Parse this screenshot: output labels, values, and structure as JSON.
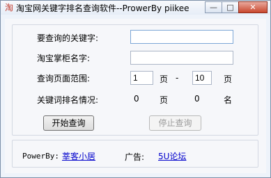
{
  "window": {
    "title": "淘宝网关键字排名查询软件--ProwerBy piikee",
    "min_glyph": "—",
    "max_glyph": "□",
    "close_glyph": "✕"
  },
  "form": {
    "keyword_label": "要查询的关键字:",
    "keyword_value": "",
    "shop_label": "淘宝掌柜名字:",
    "shop_value": "",
    "range_label": "查询页面范围:",
    "range_from": "1",
    "range_from_unit": "页",
    "range_dash": "-",
    "range_to": "10",
    "range_to_unit": "页",
    "result_label": "关键词排名情况:",
    "result_page": "0",
    "result_page_unit": "页",
    "result_rank": "0",
    "result_rank_unit": "名",
    "start_button": "开始查询",
    "stop_button": "停止查询"
  },
  "footer": {
    "powered_label": "PowerBy:",
    "powered_link": "莘客小居",
    "ad_label": "广告:",
    "ad_link": "5U论坛"
  }
}
